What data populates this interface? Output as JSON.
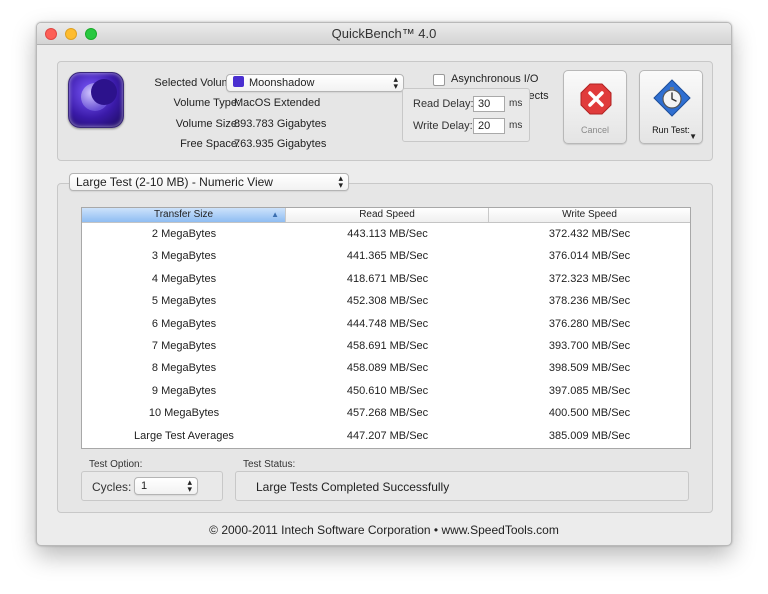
{
  "window": {
    "title": "QuickBench™ 4.0"
  },
  "volume": {
    "selected_label": "Selected Volume:",
    "selected_value": "Moonshadow",
    "type_label": "Volume Type:",
    "type_value": "MacOS Extended",
    "size_label": "Volume Size:",
    "size_value": "893.783 Gigabytes",
    "free_label": "Free Space:",
    "free_value": "763.935 Gigabytes"
  },
  "options": {
    "async_label": "Asynchronous I/O",
    "async_checked": false,
    "cache_label": "Allow Cache Effects",
    "cache_checked": false,
    "read_delay_label": "Read Delay:",
    "read_delay_value": "30",
    "read_delay_unit": "ms",
    "write_delay_label": "Write Delay:",
    "write_delay_value": "20",
    "write_delay_unit": "ms"
  },
  "buttons": {
    "cancel_label": "Cancel",
    "run_label": "Run Test:"
  },
  "view": {
    "selected": "Large Test (2-10 MB) - Numeric View"
  },
  "table": {
    "headers": [
      "Transfer Size",
      "Read Speed",
      "Write Speed"
    ],
    "sorted_column": "Transfer Size",
    "rows": [
      [
        "2 MegaBytes",
        "443.113 MB/Sec",
        "372.432 MB/Sec"
      ],
      [
        "3 MegaBytes",
        "441.365 MB/Sec",
        "376.014 MB/Sec"
      ],
      [
        "4 MegaBytes",
        "418.671 MB/Sec",
        "372.323 MB/Sec"
      ],
      [
        "5 MegaBytes",
        "452.308 MB/Sec",
        "378.236 MB/Sec"
      ],
      [
        "6 MegaBytes",
        "444.748 MB/Sec",
        "376.280 MB/Sec"
      ],
      [
        "7 MegaBytes",
        "458.691 MB/Sec",
        "393.700 MB/Sec"
      ],
      [
        "8 MegaBytes",
        "458.089 MB/Sec",
        "398.509 MB/Sec"
      ],
      [
        "9 MegaBytes",
        "450.610 MB/Sec",
        "397.085 MB/Sec"
      ],
      [
        "10 MegaBytes",
        "457.268 MB/Sec",
        "400.500 MB/Sec"
      ],
      [
        "Large Test Averages",
        "447.207 MB/Sec",
        "385.009 MB/Sec"
      ]
    ]
  },
  "test_option": {
    "group_label": "Test Option:",
    "cycles_label": "Cycles:",
    "cycles_value": "1"
  },
  "test_status": {
    "group_label": "Test Status:",
    "message": "Large Tests Completed Successfully"
  },
  "footer": {
    "copyright": "© 2000-2011 Intech Software Corporation • www.SpeedTools.com"
  },
  "colors": {
    "sorted_header": "#8fbdf2",
    "stop_red": "#e03b3b",
    "run_blue": "#2f6fd1"
  }
}
